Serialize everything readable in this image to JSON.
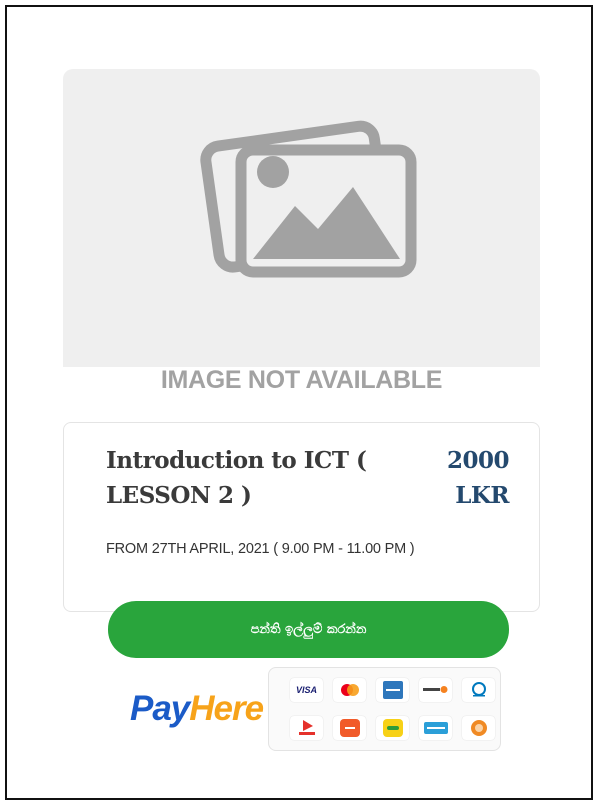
{
  "image_placeholder": {
    "text": "IMAGE NOT AVAILABLE"
  },
  "course": {
    "title": "Introduction to ICT ( LESSON 2 )",
    "price_amount": "2000",
    "price_currency": "LKR",
    "schedule": "FROM 27TH APRIL, 2021 ( 9.00 PM - 11.00 PM )"
  },
  "enroll_button": {
    "label": "පන්ති ඉල්ලුම් කරන්න"
  },
  "payment": {
    "brand_part1": "Pay",
    "brand_part2": "Here",
    "methods": [
      {
        "name": "visa-logo",
        "text": "VISA",
        "color": "#1a1f71"
      },
      {
        "name": "mastercard-logo",
        "text": "",
        "color": "#eb001b"
      },
      {
        "name": "amex-logo",
        "text": "",
        "color": "#2e77bc"
      },
      {
        "name": "discover-logo",
        "text": "",
        "color": "#f58220"
      },
      {
        "name": "diners-club-logo",
        "text": "",
        "color": "#0079be"
      },
      {
        "name": "genie-logo",
        "text": "",
        "color": "#e5312b"
      },
      {
        "name": "frimi-logo",
        "text": "",
        "color": "#f15a29"
      },
      {
        "name": "ez-cash-logo",
        "text": "",
        "color": "#f7d117"
      },
      {
        "name": "mcash-logo",
        "text": "",
        "color": "#2b9fd8"
      },
      {
        "name": "sampath-logo",
        "text": "",
        "color": "#f08a24"
      }
    ],
    "colors": {
      "pay": "#1b5bc7",
      "here": "#f7a31a"
    }
  },
  "colors": {
    "accent_green": "#29a53c",
    "price": "#24496e"
  }
}
